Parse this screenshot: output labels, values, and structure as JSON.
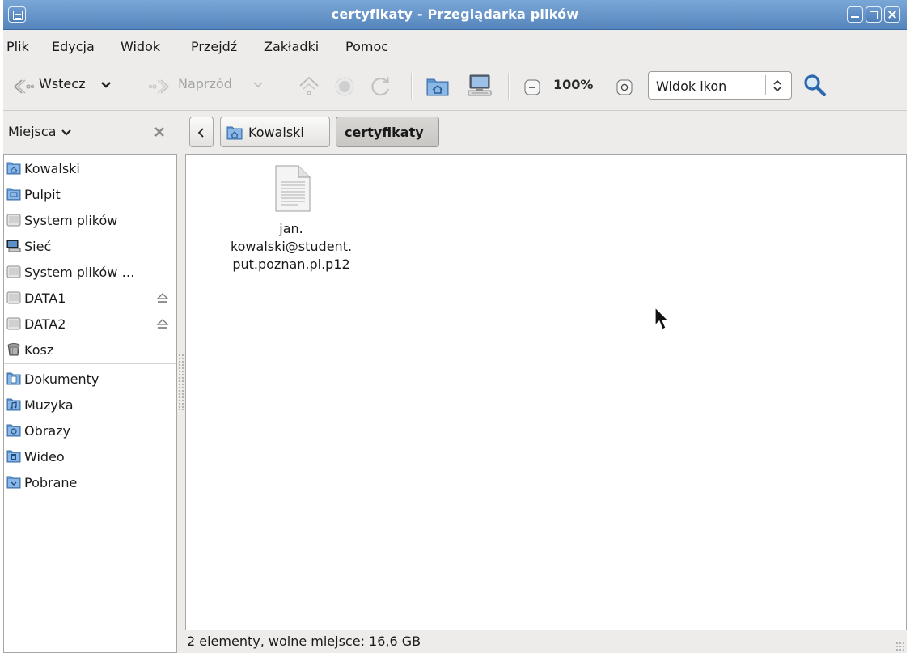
{
  "window": {
    "title": "certyfikaty - Przeglądarka plików"
  },
  "menubar": {
    "items": [
      "Plik",
      "Edycja",
      "Widok",
      "Przejdź",
      "Zakładki",
      "Pomoc"
    ]
  },
  "toolbar": {
    "back_label": "Wstecz",
    "forward_label": "Naprzód",
    "zoom_level": "100%",
    "view_mode": "Widok ikon"
  },
  "places": {
    "header_label": "Miejsca",
    "items": [
      {
        "label": "Kowalski",
        "icon": "home-folder-icon"
      },
      {
        "label": "Pulpit",
        "icon": "desktop-folder-icon"
      },
      {
        "label": "System plików",
        "icon": "drive-icon"
      },
      {
        "label": "Sieć",
        "icon": "network-icon"
      },
      {
        "label": "System plików …",
        "icon": "drive-icon"
      },
      {
        "label": "DATA1",
        "icon": "drive-icon",
        "eject": true
      },
      {
        "label": "DATA2",
        "icon": "drive-icon",
        "eject": true
      },
      {
        "label": "Kosz",
        "icon": "trash-icon"
      }
    ],
    "bookmarks": [
      {
        "label": "Dokumenty",
        "icon": "documents-folder-icon"
      },
      {
        "label": "Muzyka",
        "icon": "music-folder-icon"
      },
      {
        "label": "Obrazy",
        "icon": "pictures-folder-icon"
      },
      {
        "label": "Wideo",
        "icon": "videos-folder-icon"
      },
      {
        "label": "Pobrane",
        "icon": "downloads-folder-icon"
      }
    ]
  },
  "pathbar": {
    "items": [
      "Kowalski",
      "certyfikaty"
    ],
    "active": "certyfikaty"
  },
  "files": [
    {
      "name_lines": [
        "jan.",
        "kowalski@student.",
        "put.poznan.pl.p12"
      ],
      "icon": "text-file-icon"
    }
  ],
  "statusbar": {
    "text": "2 elementy, wolne miejsce: 16,6 GB"
  },
  "colors": {
    "titlebar": "#5f8fc6",
    "folder": "#4a86c5",
    "background": "#edeceb"
  }
}
